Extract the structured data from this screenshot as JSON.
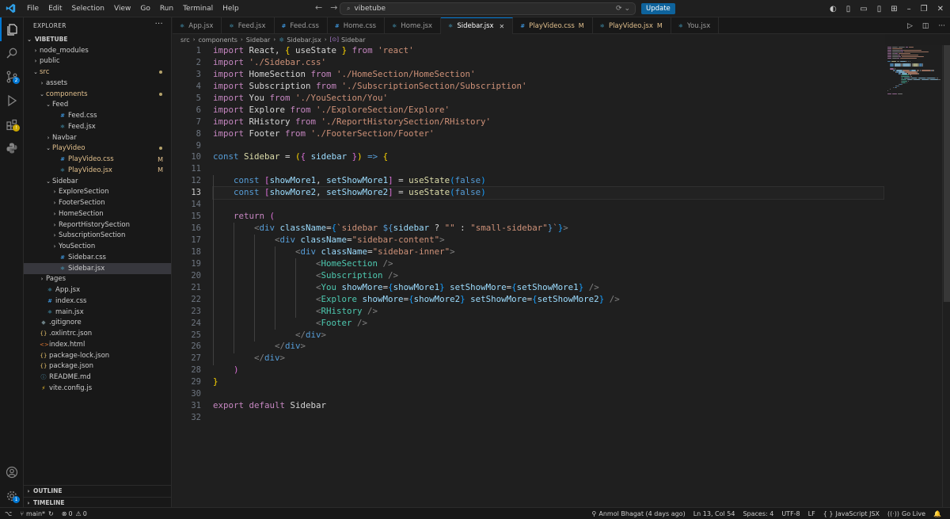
{
  "titlebar": {
    "menu": [
      "File",
      "Edit",
      "Selection",
      "View",
      "Go",
      "Run",
      "Terminal",
      "Help"
    ],
    "command_center": "vibetube",
    "update_button": "Update",
    "colors": {
      "accent": "#0078d4",
      "update": "#0e639c"
    }
  },
  "activity": {
    "source_control_badge": "2",
    "manage_badge": "1"
  },
  "explorer": {
    "header": "EXPLORER",
    "root": "VIBETUBE",
    "items": [
      {
        "label": "node_modules",
        "depth": 1,
        "kind": "folder",
        "open": false
      },
      {
        "label": "public",
        "depth": 1,
        "kind": "folder",
        "open": false
      },
      {
        "label": "src",
        "depth": 1,
        "kind": "folder",
        "open": true,
        "color": "#e2c08d",
        "dot": "#b5a36b"
      },
      {
        "label": "assets",
        "depth": 2,
        "kind": "folder",
        "open": false
      },
      {
        "label": "components",
        "depth": 2,
        "kind": "folder",
        "open": true,
        "color": "#e2c08d",
        "dot": "#b5a36b"
      },
      {
        "label": "Feed",
        "depth": 3,
        "kind": "folder",
        "open": true
      },
      {
        "label": "Feed.css",
        "depth": 4,
        "kind": "css"
      },
      {
        "label": "Feed.jsx",
        "depth": 4,
        "kind": "jsx"
      },
      {
        "label": "Navbar",
        "depth": 3,
        "kind": "folder",
        "open": false
      },
      {
        "label": "PlayVideo",
        "depth": 3,
        "kind": "folder",
        "open": true,
        "color": "#e2c08d",
        "dot": "#b5a36b"
      },
      {
        "label": "PlayVideo.css",
        "depth": 4,
        "kind": "css",
        "color": "#e2c08d",
        "mark": "M"
      },
      {
        "label": "PlayVideo.jsx",
        "depth": 4,
        "kind": "jsx",
        "color": "#e2c08d",
        "mark": "M"
      },
      {
        "label": "Sidebar",
        "depth": 3,
        "kind": "folder",
        "open": true
      },
      {
        "label": "ExploreSection",
        "depth": 4,
        "kind": "folder",
        "open": false
      },
      {
        "label": "FooterSection",
        "depth": 4,
        "kind": "folder",
        "open": false
      },
      {
        "label": "HomeSection",
        "depth": 4,
        "kind": "folder",
        "open": false
      },
      {
        "label": "ReportHistorySection",
        "depth": 4,
        "kind": "folder",
        "open": false
      },
      {
        "label": "SubscriptionSection",
        "depth": 4,
        "kind": "folder",
        "open": false
      },
      {
        "label": "YouSection",
        "depth": 4,
        "kind": "folder",
        "open": false
      },
      {
        "label": "Sidebar.css",
        "depth": 4,
        "kind": "css"
      },
      {
        "label": "Sidebar.jsx",
        "depth": 4,
        "kind": "jsx",
        "selected": true
      },
      {
        "label": "Pages",
        "depth": 2,
        "kind": "folder",
        "open": false
      },
      {
        "label": "App.jsx",
        "depth": 2,
        "kind": "jsx"
      },
      {
        "label": "index.css",
        "depth": 2,
        "kind": "css"
      },
      {
        "label": "main.jsx",
        "depth": 2,
        "kind": "jsx"
      },
      {
        "label": ".gitignore",
        "depth": 1,
        "kind": "git"
      },
      {
        "label": ".oxlintrc.json",
        "depth": 1,
        "kind": "json"
      },
      {
        "label": "index.html",
        "depth": 1,
        "kind": "html"
      },
      {
        "label": "package-lock.json",
        "depth": 1,
        "kind": "json"
      },
      {
        "label": "package.json",
        "depth": 1,
        "kind": "json"
      },
      {
        "label": "README.md",
        "depth": 1,
        "kind": "info"
      },
      {
        "label": "vite.config.js",
        "depth": 1,
        "kind": "vite"
      }
    ],
    "outline": "OUTLINE",
    "timeline": "TIMELINE"
  },
  "tabs": [
    {
      "label": "App.jsx",
      "kind": "jsx"
    },
    {
      "label": "Feed.jsx",
      "kind": "jsx"
    },
    {
      "label": "Feed.css",
      "kind": "css"
    },
    {
      "label": "Home.css",
      "kind": "css"
    },
    {
      "label": "Home.jsx",
      "kind": "jsx"
    },
    {
      "label": "Sidebar.jsx",
      "kind": "jsx",
      "active": true
    },
    {
      "label": "PlayVideo.css",
      "kind": "css",
      "modified": "M"
    },
    {
      "label": "PlayVideo.jsx",
      "kind": "jsx",
      "modified": "M"
    },
    {
      "label": "You.jsx",
      "kind": "jsx"
    }
  ],
  "breadcrumb": [
    "src",
    "components",
    "Sidebar",
    "Sidebar.jsx",
    "Sidebar"
  ],
  "editor": {
    "current_line": 13,
    "lines": [
      [
        [
          "kw",
          "import"
        ],
        [
          "pl",
          " React, "
        ],
        [
          "br1",
          "{"
        ],
        [
          "pl",
          " useState "
        ],
        [
          "br1",
          "}"
        ],
        [
          "kw",
          " from"
        ],
        [
          "str",
          " 'react'"
        ]
      ],
      [
        [
          "kw",
          "import"
        ],
        [
          "str",
          " './Sidebar.css'"
        ]
      ],
      [
        [
          "kw",
          "import"
        ],
        [
          "pl",
          " HomeSection "
        ],
        [
          "kw",
          "from"
        ],
        [
          "str",
          " './HomeSection/HomeSection'"
        ]
      ],
      [
        [
          "kw",
          "import"
        ],
        [
          "pl",
          " Subscription "
        ],
        [
          "kw",
          "from"
        ],
        [
          "str",
          " './SubscriptionSection/Subscription'"
        ]
      ],
      [
        [
          "kw",
          "import"
        ],
        [
          "pl",
          " You "
        ],
        [
          "kw",
          "from"
        ],
        [
          "str",
          " './YouSection/You'"
        ]
      ],
      [
        [
          "kw",
          "import"
        ],
        [
          "pl",
          " Explore "
        ],
        [
          "kw",
          "from"
        ],
        [
          "str",
          " './ExploreSection/Explore'"
        ]
      ],
      [
        [
          "kw",
          "import"
        ],
        [
          "pl",
          " RHistory "
        ],
        [
          "kw",
          "from"
        ],
        [
          "str",
          " './ReportHistorySection/RHistory'"
        ]
      ],
      [
        [
          "kw",
          "import"
        ],
        [
          "pl",
          " Footer "
        ],
        [
          "kw",
          "from"
        ],
        [
          "str",
          " './FooterSection/Footer'"
        ]
      ],
      [],
      [
        [
          "kw2",
          "const"
        ],
        [
          "fn",
          " Sidebar"
        ],
        [
          "pl",
          " = "
        ],
        [
          "br1",
          "("
        ],
        [
          "br2",
          "{"
        ],
        [
          "id",
          " sidebar "
        ],
        [
          "br2",
          "}"
        ],
        [
          "br1",
          ")"
        ],
        [
          "kw2",
          " =>"
        ],
        [
          "pl",
          " "
        ],
        [
          "br1",
          "{"
        ]
      ],
      [],
      [
        [
          "pl",
          "    "
        ],
        [
          "kw2",
          "const"
        ],
        [
          "pl",
          " "
        ],
        [
          "br2",
          "["
        ],
        [
          "id",
          "showMore1"
        ],
        [
          "pl",
          ", "
        ],
        [
          "id",
          "setShowMore1"
        ],
        [
          "br2",
          "]"
        ],
        [
          "pl",
          " = "
        ],
        [
          "fn",
          "useState"
        ],
        [
          "br3",
          "("
        ],
        [
          "kw2",
          "false"
        ],
        [
          "br3",
          ")"
        ]
      ],
      [
        [
          "pl",
          "    "
        ],
        [
          "kw2",
          "const"
        ],
        [
          "pl",
          " "
        ],
        [
          "br2",
          "["
        ],
        [
          "id",
          "showMore2"
        ],
        [
          "pl",
          ", "
        ],
        [
          "id",
          "setShowMore2"
        ],
        [
          "br2",
          "]"
        ],
        [
          "pl",
          " = "
        ],
        [
          "fn",
          "useState"
        ],
        [
          "br3",
          "("
        ],
        [
          "kw2",
          "false"
        ],
        [
          "br3",
          ")"
        ]
      ],
      [],
      [
        [
          "pl",
          "    "
        ],
        [
          "kw",
          "return"
        ],
        [
          "pl",
          " "
        ],
        [
          "br2",
          "("
        ]
      ],
      [
        [
          "pl",
          "        "
        ],
        [
          "ang",
          "<"
        ],
        [
          "tag",
          "div"
        ],
        [
          "attr",
          " className"
        ],
        [
          "pl",
          "="
        ],
        [
          "br3",
          "{"
        ],
        [
          "str",
          "`sidebar "
        ],
        [
          "kw2",
          "${"
        ],
        [
          "id",
          "sidebar"
        ],
        [
          "pl",
          " ? "
        ],
        [
          "str",
          "\"\""
        ],
        [
          "pl",
          " : "
        ],
        [
          "str",
          "\"small-sidebar\""
        ],
        [
          "kw2",
          "}"
        ],
        [
          "str",
          "`"
        ],
        [
          "br3",
          "}"
        ],
        [
          "ang",
          ">"
        ]
      ],
      [
        [
          "pl",
          "            "
        ],
        [
          "ang",
          "<"
        ],
        [
          "tag",
          "div"
        ],
        [
          "attr",
          " className"
        ],
        [
          "pl",
          "="
        ],
        [
          "str",
          "\"sidebar-content\""
        ],
        [
          "ang",
          ">"
        ]
      ],
      [
        [
          "pl",
          "                "
        ],
        [
          "ang",
          "<"
        ],
        [
          "tag",
          "div"
        ],
        [
          "attr",
          " className"
        ],
        [
          "pl",
          "="
        ],
        [
          "str",
          "\"sidebar-inner\""
        ],
        [
          "ang",
          ">"
        ]
      ],
      [
        [
          "pl",
          "                    "
        ],
        [
          "ang",
          "<"
        ],
        [
          "comp",
          "HomeSection"
        ],
        [
          "ang",
          " />"
        ]
      ],
      [
        [
          "pl",
          "                    "
        ],
        [
          "ang",
          "<"
        ],
        [
          "comp",
          "Subscription"
        ],
        [
          "ang",
          " />"
        ]
      ],
      [
        [
          "pl",
          "                    "
        ],
        [
          "ang",
          "<"
        ],
        [
          "comp",
          "You"
        ],
        [
          "attr",
          " showMore"
        ],
        [
          "pl",
          "="
        ],
        [
          "br3",
          "{"
        ],
        [
          "id",
          "showMore1"
        ],
        [
          "br3",
          "}"
        ],
        [
          "attr",
          " setShowMore"
        ],
        [
          "pl",
          "="
        ],
        [
          "br3",
          "{"
        ],
        [
          "id",
          "setShowMore1"
        ],
        [
          "br3",
          "}"
        ],
        [
          "ang",
          " />"
        ]
      ],
      [
        [
          "pl",
          "                    "
        ],
        [
          "ang",
          "<"
        ],
        [
          "comp",
          "Explore"
        ],
        [
          "attr",
          " showMore"
        ],
        [
          "pl",
          "="
        ],
        [
          "br3",
          "{"
        ],
        [
          "id",
          "showMore2"
        ],
        [
          "br3",
          "}"
        ],
        [
          "attr",
          " setShowMore"
        ],
        [
          "pl",
          "="
        ],
        [
          "br3",
          "{"
        ],
        [
          "id",
          "setShowMore2"
        ],
        [
          "br3",
          "}"
        ],
        [
          "ang",
          " />"
        ]
      ],
      [
        [
          "pl",
          "                    "
        ],
        [
          "ang",
          "<"
        ],
        [
          "comp",
          "RHistory"
        ],
        [
          "ang",
          " />"
        ]
      ],
      [
        [
          "pl",
          "                    "
        ],
        [
          "ang",
          "<"
        ],
        [
          "comp",
          "Footer"
        ],
        [
          "ang",
          " />"
        ]
      ],
      [
        [
          "pl",
          "                "
        ],
        [
          "ang",
          "</"
        ],
        [
          "tag",
          "div"
        ],
        [
          "ang",
          ">"
        ]
      ],
      [
        [
          "pl",
          "            "
        ],
        [
          "ang",
          "</"
        ],
        [
          "tag",
          "div"
        ],
        [
          "ang",
          ">"
        ]
      ],
      [
        [
          "pl",
          "        "
        ],
        [
          "ang",
          "</"
        ],
        [
          "tag",
          "div"
        ],
        [
          "ang",
          ">"
        ]
      ],
      [
        [
          "pl",
          "    "
        ],
        [
          "br2",
          ")"
        ]
      ],
      [
        [
          "br1",
          "}"
        ]
      ],
      [],
      [
        [
          "kw",
          "export"
        ],
        [
          "kw",
          " default"
        ],
        [
          "pl",
          " Sidebar"
        ]
      ],
      []
    ]
  },
  "statusbar": {
    "branch": "main*",
    "problems": "0",
    "warnings": "0",
    "blame": "Anmol Bhagat (4 days ago)",
    "position": "Ln 13, Col 54",
    "spaces": "Spaces: 4",
    "encoding": "UTF-8",
    "eol": "LF",
    "language": "JavaScript JSX",
    "golive": "Go Live"
  }
}
